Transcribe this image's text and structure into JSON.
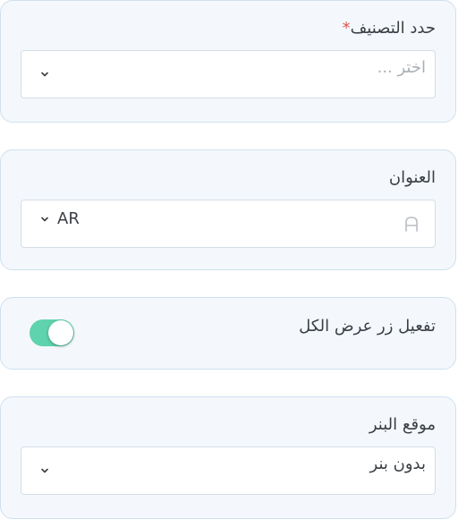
{
  "category": {
    "label": "حدد التصنيف",
    "required_mark": "*",
    "placeholder": "اختر ...",
    "icon": "chevron-down-icon"
  },
  "title_field": {
    "label": "العنوان",
    "language_code": "AR",
    "value": "",
    "icons": [
      "chevron-down-icon",
      "text-a-icon"
    ]
  },
  "view_all": {
    "label": "تفعيل زر عرض الكل",
    "enabled": true,
    "accent_color": "#5fd3ad"
  },
  "banner_position": {
    "label": "موقع البنر",
    "selected": "بدون بنر",
    "icon": "chevron-down-icon"
  },
  "colors": {
    "card_background": "#f4f8fc",
    "card_border": "#cfe0ef",
    "required": "#e5534b"
  }
}
